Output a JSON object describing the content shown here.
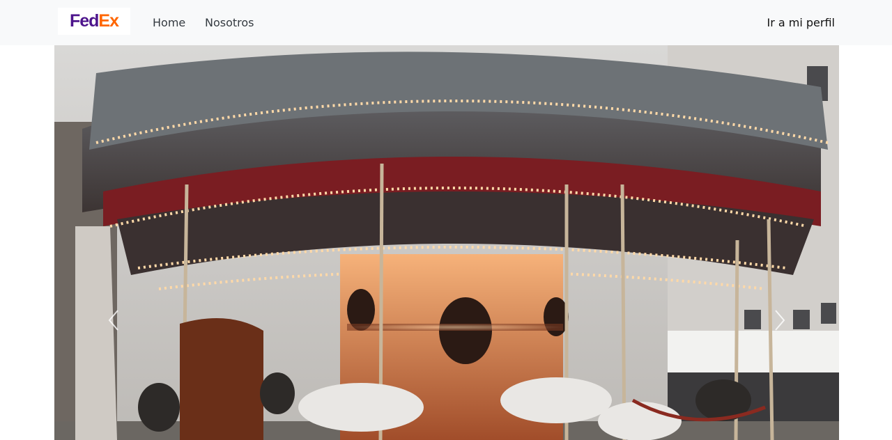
{
  "navbar": {
    "brand": {
      "fed": "Fed",
      "ex": "Ex",
      "colors": {
        "fed": "#4d148c",
        "ex": "#ff6600"
      }
    },
    "links": [
      {
        "label": "Home"
      },
      {
        "label": "Nosotros"
      }
    ],
    "profile_label": "Ir a mi perfil",
    "background": "#f8f9fa"
  },
  "carousel": {
    "slide_image": "carousel-photo",
    "prev_icon": "chevron-left-icon",
    "next_icon": "chevron-right-icon"
  }
}
